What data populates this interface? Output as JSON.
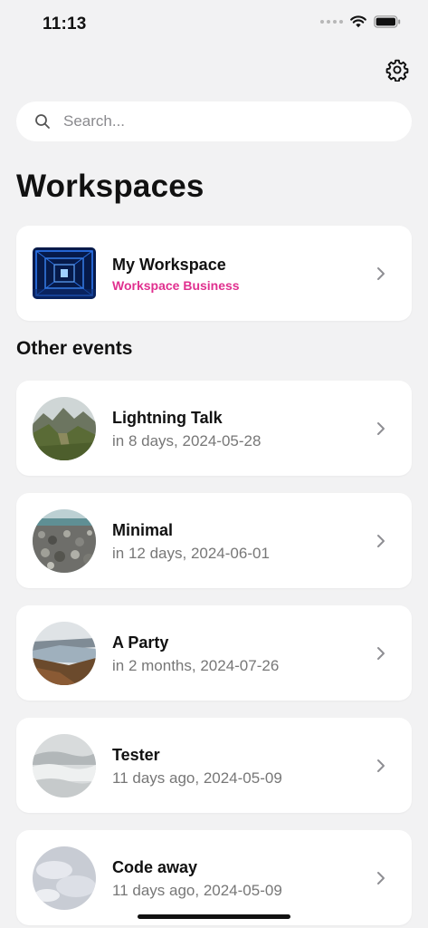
{
  "status_bar": {
    "time": "11:13",
    "icons": [
      "signal-dots-icon",
      "wifi-icon",
      "battery-icon"
    ]
  },
  "header": {
    "settings_icon": "gear-icon"
  },
  "search": {
    "placeholder": "Search...",
    "value": ""
  },
  "page_title": "Workspaces",
  "workspace": {
    "name": "My Workspace",
    "plan": "Workspace Business",
    "plan_color": "#e0308f"
  },
  "other_events_title": "Other events",
  "events": [
    {
      "name": "Lightning Talk",
      "when": "in 8 days, 2024-05-28"
    },
    {
      "name": "Minimal",
      "when": "in 12 days, 2024-06-01"
    },
    {
      "name": "A Party",
      "when": "in 2 months, 2024-07-26"
    },
    {
      "name": "Tester",
      "when": "11 days ago, 2024-05-09"
    },
    {
      "name": "Code away",
      "when": "11 days ago, 2024-05-09"
    }
  ],
  "colors": {
    "background": "#f2f2f3",
    "card": "#ffffff",
    "accent": "#e0308f",
    "secondary_text": "#777777"
  }
}
